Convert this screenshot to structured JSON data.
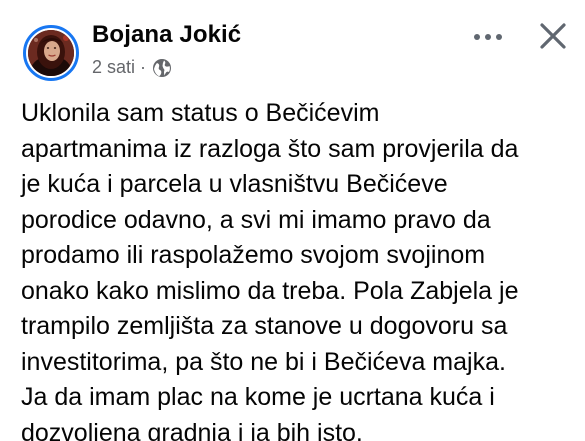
{
  "post": {
    "author": "Bojana Jokić",
    "time": "2 sati",
    "separator": "·",
    "audience_icon": "globe-icon",
    "more_icon": "more-horizontal-icon",
    "close_icon": "close-icon",
    "lines": [
      "Uklonila sam status o Bečićevim",
      "apartmanima iz razloga što sam provjerila da",
      "je kuća i parcela u vlasništvu Bečićeve",
      "porodice odavno, a svi mi imamo pravo da",
      "prodamo ili raspolažemo svojom svojinom",
      "onako kako mislimo da treba. Pola Zabjela je",
      "trampilo zemljišta za stanove u dogovoru sa",
      "investitorima, pa što ne bi i Bečićeva majka.",
      "Ja da imam plac na kome je ucrtana kuća i",
      "dozvoljena gradnja i ja bih isto."
    ]
  },
  "colors": {
    "avatar_ring": "#1877f2",
    "secondary_text": "#65676b",
    "icon_gray": "#606770",
    "text": "#050505"
  }
}
